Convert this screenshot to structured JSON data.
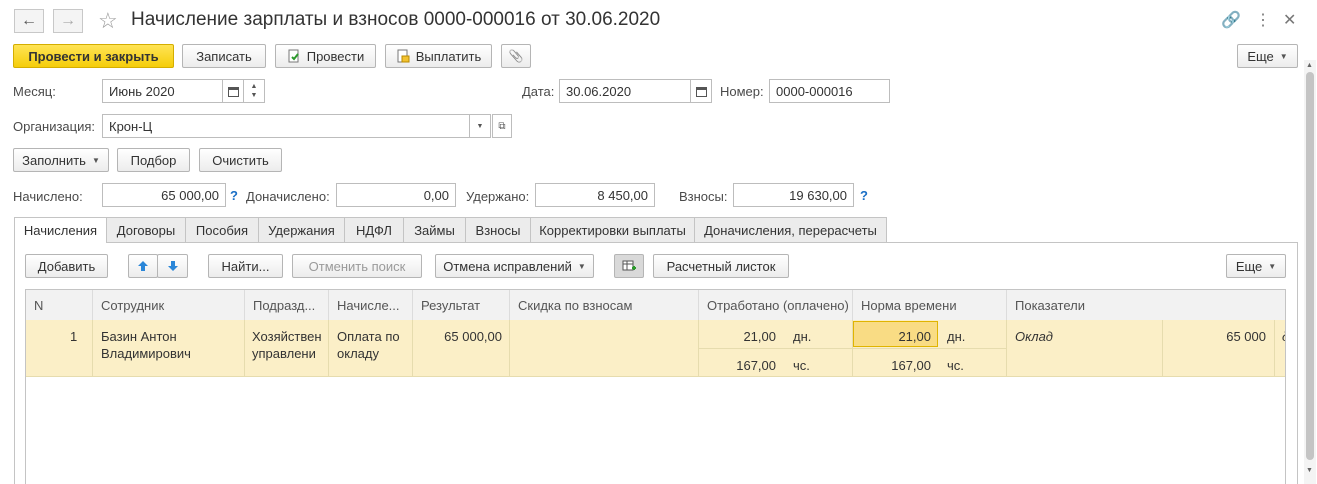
{
  "window": {
    "title": "Начисление зарплаты и взносов 0000-000016 от 30.06.2020",
    "back_icon": "←",
    "forward_icon": "→",
    "star_icon": "☆",
    "link_icon": "🔗",
    "menu_icon": "⋮",
    "close_icon": "✕"
  },
  "toolbar": {
    "post_close": "Провести и закрыть",
    "save": "Записать",
    "post": "Провести",
    "pay": "Выплатить",
    "attach_icon": "📎",
    "more": "Еще"
  },
  "form": {
    "month_label": "Месяц:",
    "month_value": "Июнь 2020",
    "date_label": "Дата:",
    "date_value": "30.06.2020",
    "number_label": "Номер:",
    "number_value": "0000-000016",
    "org_label": "Организация:",
    "org_value": "Крон-Ц"
  },
  "actions": {
    "fill": "Заполнить",
    "select": "Подбор",
    "clear": "Очистить"
  },
  "totals": {
    "accrued_label": "Начислено:",
    "accrued_value": "65 000,00",
    "additional_label": "Доначислено:",
    "additional_value": "0,00",
    "withheld_label": "Удержано:",
    "withheld_value": "8 450,00",
    "contrib_label": "Взносы:",
    "contrib_value": "19 630,00",
    "help": "?"
  },
  "tabs": [
    "Начисления",
    "Договоры",
    "Пособия",
    "Удержания",
    "НДФЛ",
    "Займы",
    "Взносы",
    "Корректировки выплаты",
    "Доначисления, перерасчеты"
  ],
  "table_toolbar": {
    "add": "Добавить",
    "find": "Найти...",
    "cancel_search": "Отменить поиск",
    "cancel_corrections": "Отмена исправлений",
    "payslip": "Расчетный листок",
    "more": "Еще"
  },
  "table": {
    "headers": [
      "N",
      "Сотрудник",
      "Подразд...",
      "Начисле...",
      "Результат",
      "Скидка по взносам",
      "Отработано (оплачено)",
      "Норма времени",
      "Показатели"
    ],
    "row": {
      "n": "1",
      "employee_line1": "Базин Антон",
      "employee_line2": "Владимирович",
      "dept_line1": "Хозяйствен",
      "dept_line2": "управлени",
      "accrual_line1": "Оплата по",
      "accrual_line2": "окладу",
      "result": "65 000,00",
      "worked_days": "21,00",
      "worked_days_unit": "дн.",
      "worked_hours": "167,00",
      "worked_hours_unit": "чс.",
      "norm_days": "21,00",
      "norm_days_unit": "дн.",
      "norm_hours": "167,00",
      "norm_hours_unit": "чс.",
      "indicator_name": "Оклад",
      "indicator_value": "65 000",
      "indicator_trunc": "д"
    }
  }
}
